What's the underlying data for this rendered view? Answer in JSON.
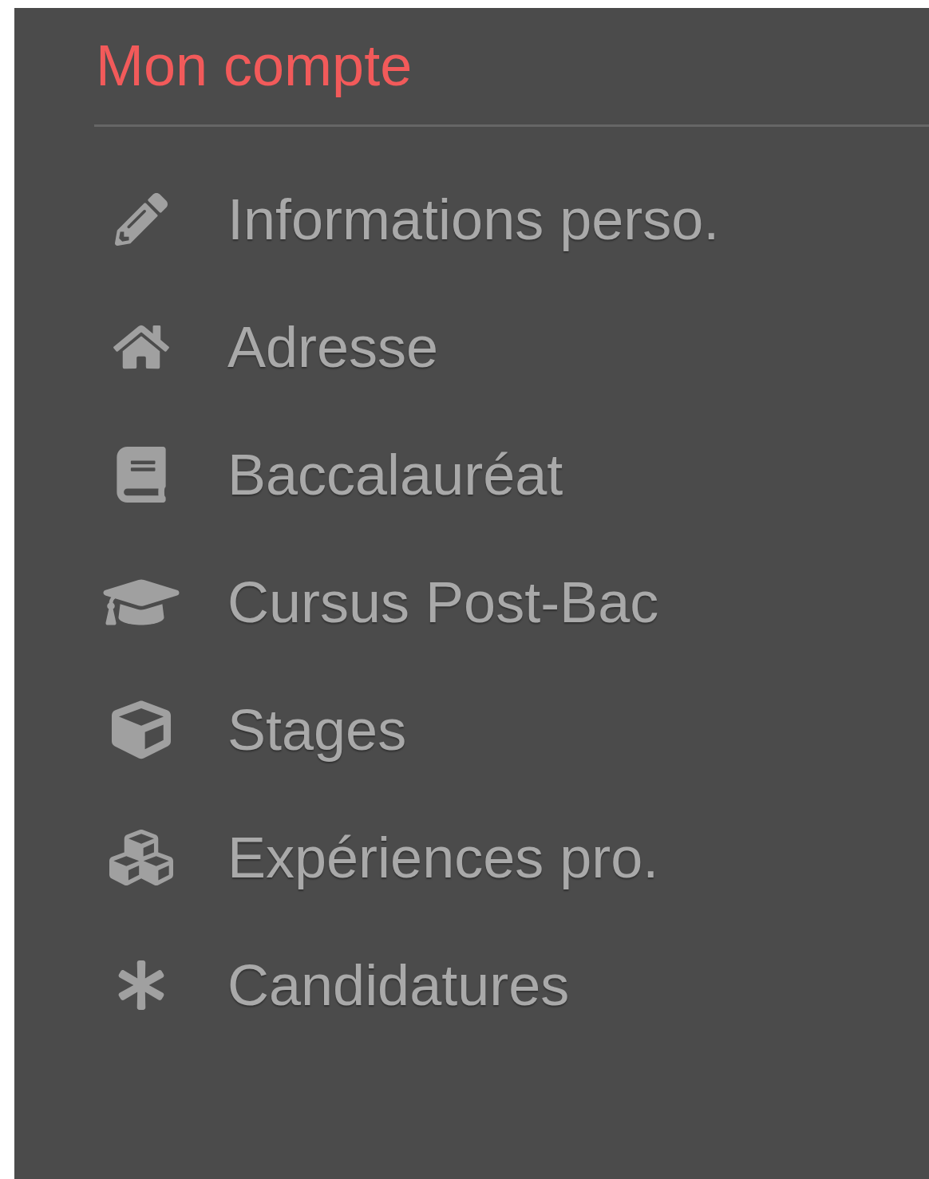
{
  "menu": {
    "title": "Mon compte",
    "items": [
      {
        "label": "Informations perso."
      },
      {
        "label": "Adresse"
      },
      {
        "label": "Baccalauréat"
      },
      {
        "label": "Cursus Post-Bac"
      },
      {
        "label": "Stages"
      },
      {
        "label": "Expériences pro."
      },
      {
        "label": "Candidatures"
      }
    ]
  }
}
